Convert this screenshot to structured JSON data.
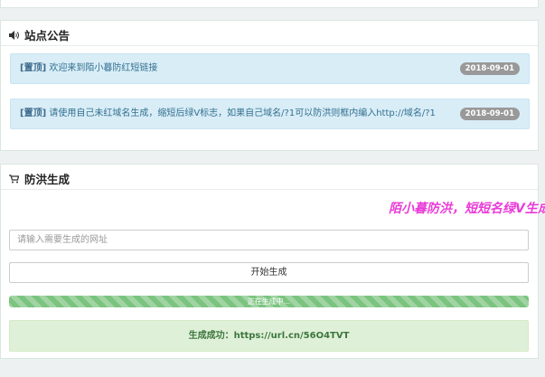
{
  "notice": {
    "title": "站点公告",
    "items": [
      {
        "tag": "[置顶]",
        "text": " 欢迎来到陌小暮防红短链接",
        "date": "2018-09-01"
      },
      {
        "tag": "[置顶]",
        "text": " 请使用自己未红域名生成，缩短后绿V标志，如果自己域名/?1可以防洪则框内编入http://域名/?1",
        "date": "2018-09-01"
      }
    ]
  },
  "generator": {
    "title": "防洪生成",
    "marquee": "陌小暮防洪，短短名绿V生成",
    "input_placeholder": "请输入需要生成的网址",
    "button_label": "开始生成",
    "progress_label": "正在生成中...",
    "progress_value": 1.0,
    "result_text": "生成成功：https://url.cn/56O4TVT"
  }
}
